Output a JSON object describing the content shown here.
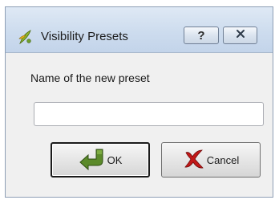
{
  "window": {
    "title": "Visibility Presets",
    "icons": {
      "app": "qgis-icon",
      "help": "help-icon",
      "close": "close-icon"
    }
  },
  "form": {
    "name_label": "Name of the new preset",
    "name_value": "",
    "name_placeholder": ""
  },
  "buttons": {
    "ok_label": "OK",
    "ok_icon": "ok-arrow-icon",
    "cancel_label": "Cancel",
    "cancel_icon": "red-x-icon"
  },
  "colors": {
    "ok_icon": "#5b8a2a",
    "cancel_icon": "#c21818",
    "app_icon": "#8fb82d"
  }
}
